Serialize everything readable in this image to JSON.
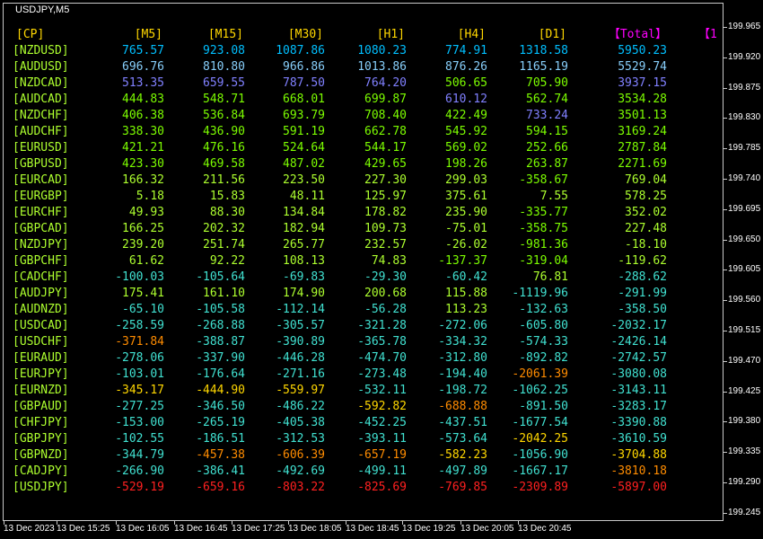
{
  "window": {
    "title": "USDJPY,M5"
  },
  "colors": {
    "background": "#000000",
    "header_gold": "#ffd700",
    "header_magenta": "#ff00ff",
    "pair_label": "#adff2f",
    "strong_blue": "#00bfff",
    "light_blue": "#87cefa",
    "slate_blue": "#8080ff",
    "green": "#7cfc00",
    "lime": "#adff2f",
    "aqua": "#40e0d0",
    "gold": "#ffd700",
    "orange": "#ff8c00",
    "tomato": "#ff6347",
    "red": "#ff2020"
  },
  "table": {
    "headers": [
      "[CP]",
      "[M5]",
      "[M15]",
      "[M30]",
      "[H1]",
      "[H4]",
      "[D1]",
      "【Total】",
      "【1"
    ],
    "rows": [
      {
        "pair": "[NZDUSD]",
        "values": [
          "765.57",
          "923.08",
          "1087.86",
          "1080.23",
          "774.91",
          "1318.58",
          "5950.23"
        ],
        "colors": [
          "strong_blue",
          "strong_blue",
          "strong_blue",
          "strong_blue",
          "strong_blue",
          "strong_blue",
          "strong_blue"
        ]
      },
      {
        "pair": "[AUDUSD]",
        "values": [
          "696.76",
          "810.80",
          "966.86",
          "1013.86",
          "876.26",
          "1165.19",
          "5529.74"
        ],
        "colors": [
          "light_blue",
          "light_blue",
          "light_blue",
          "light_blue",
          "light_blue",
          "light_blue",
          "light_blue"
        ]
      },
      {
        "pair": "[NZDCAD]",
        "values": [
          "513.35",
          "659.55",
          "787.50",
          "764.20",
          "506.65",
          "705.90",
          "3937.15"
        ],
        "colors": [
          "slate_blue",
          "slate_blue",
          "slate_blue",
          "slate_blue",
          "green",
          "green",
          "slate_blue"
        ]
      },
      {
        "pair": "[AUDCAD]",
        "values": [
          "444.83",
          "548.71",
          "668.01",
          "699.87",
          "610.12",
          "562.74",
          "3534.28"
        ],
        "colors": [
          "green",
          "green",
          "green",
          "green",
          "slate_blue",
          "green",
          "green"
        ]
      },
      {
        "pair": "[NZDCHF]",
        "values": [
          "406.38",
          "536.84",
          "693.79",
          "708.40",
          "422.49",
          "733.24",
          "3501.13"
        ],
        "colors": [
          "green",
          "green",
          "green",
          "green",
          "green",
          "slate_blue",
          "green"
        ]
      },
      {
        "pair": "[AUDCHF]",
        "values": [
          "338.30",
          "436.90",
          "591.19",
          "662.78",
          "545.92",
          "594.15",
          "3169.24"
        ],
        "colors": [
          "green",
          "green",
          "green",
          "green",
          "green",
          "green",
          "green"
        ]
      },
      {
        "pair": "[EURUSD]",
        "values": [
          "421.21",
          "476.16",
          "524.64",
          "544.17",
          "569.02",
          "252.66",
          "2787.84"
        ],
        "colors": [
          "green",
          "green",
          "green",
          "green",
          "green",
          "green",
          "green"
        ]
      },
      {
        "pair": "[GBPUSD]",
        "values": [
          "423.30",
          "469.58",
          "487.02",
          "429.65",
          "198.26",
          "263.87",
          "2271.69"
        ],
        "colors": [
          "green",
          "green",
          "green",
          "green",
          "green",
          "green",
          "green"
        ]
      },
      {
        "pair": "[EURCAD]",
        "values": [
          "166.32",
          "211.56",
          "223.50",
          "227.30",
          "299.03",
          "-358.67",
          "769.04"
        ],
        "colors": [
          "lime",
          "lime",
          "lime",
          "lime",
          "lime",
          "green",
          "lime"
        ]
      },
      {
        "pair": "[EURGBP]",
        "values": [
          "5.18",
          "15.83",
          "48.11",
          "125.97",
          "375.61",
          "7.55",
          "578.25"
        ],
        "colors": [
          "lime",
          "lime",
          "lime",
          "lime",
          "lime",
          "lime",
          "lime"
        ]
      },
      {
        "pair": "[EURCHF]",
        "values": [
          "49.93",
          "88.30",
          "134.84",
          "178.82",
          "235.90",
          "-335.77",
          "352.02"
        ],
        "colors": [
          "lime",
          "lime",
          "lime",
          "lime",
          "lime",
          "green",
          "lime"
        ]
      },
      {
        "pair": "[GBPCAD]",
        "values": [
          "166.25",
          "202.32",
          "182.94",
          "109.73",
          "-75.01",
          "-358.75",
          "227.48"
        ],
        "colors": [
          "lime",
          "lime",
          "lime",
          "lime",
          "lime",
          "green",
          "lime"
        ]
      },
      {
        "pair": "[NZDJPY]",
        "values": [
          "239.20",
          "251.74",
          "265.77",
          "232.57",
          "-26.02",
          "-981.36",
          "-18.10"
        ],
        "colors": [
          "lime",
          "lime",
          "lime",
          "lime",
          "lime",
          "green",
          "lime"
        ]
      },
      {
        "pair": "[GBPCHF]",
        "values": [
          "61.62",
          "92.22",
          "108.13",
          "74.83",
          "-137.37",
          "-319.04",
          "-119.62"
        ],
        "colors": [
          "lime",
          "lime",
          "lime",
          "lime",
          "green",
          "green",
          "lime"
        ]
      },
      {
        "pair": "[CADCHF]",
        "values": [
          "-100.03",
          "-105.64",
          "-69.83",
          "-29.30",
          "-60.42",
          "76.81",
          "-288.62"
        ],
        "colors": [
          "aqua",
          "aqua",
          "aqua",
          "aqua",
          "aqua",
          "lime",
          "aqua"
        ]
      },
      {
        "pair": "[AUDJPY]",
        "values": [
          "175.41",
          "161.10",
          "174.90",
          "200.68",
          "115.88",
          "-1119.96",
          "-291.99"
        ],
        "colors": [
          "lime",
          "lime",
          "lime",
          "lime",
          "lime",
          "aqua",
          "aqua"
        ]
      },
      {
        "pair": "[AUDNZD]",
        "values": [
          "-65.10",
          "-105.58",
          "-112.14",
          "-56.28",
          "113.23",
          "-132.63",
          "-358.50"
        ],
        "colors": [
          "aqua",
          "aqua",
          "aqua",
          "aqua",
          "lime",
          "aqua",
          "aqua"
        ]
      },
      {
        "pair": "[USDCAD]",
        "values": [
          "-258.59",
          "-268.88",
          "-305.57",
          "-321.28",
          "-272.06",
          "-605.80",
          "-2032.17"
        ],
        "colors": [
          "aqua",
          "aqua",
          "aqua",
          "aqua",
          "aqua",
          "aqua",
          "aqua"
        ]
      },
      {
        "pair": "[USDCHF]",
        "values": [
          "-371.84",
          "-388.87",
          "-390.89",
          "-365.78",
          "-334.32",
          "-574.33",
          "-2426.14"
        ],
        "colors": [
          "orange",
          "aqua",
          "aqua",
          "aqua",
          "aqua",
          "aqua",
          "aqua"
        ]
      },
      {
        "pair": "[EURAUD]",
        "values": [
          "-278.06",
          "-337.90",
          "-446.28",
          "-474.70",
          "-312.80",
          "-892.82",
          "-2742.57"
        ],
        "colors": [
          "aqua",
          "aqua",
          "aqua",
          "aqua",
          "aqua",
          "aqua",
          "aqua"
        ]
      },
      {
        "pair": "[EURJPY]",
        "values": [
          "-103.01",
          "-176.64",
          "-271.16",
          "-273.48",
          "-194.40",
          "-2061.39",
          "-3080.08"
        ],
        "colors": [
          "aqua",
          "aqua",
          "aqua",
          "aqua",
          "aqua",
          "orange",
          "aqua"
        ]
      },
      {
        "pair": "[EURNZD]",
        "values": [
          "-345.17",
          "-444.90",
          "-559.97",
          "-532.11",
          "-198.72",
          "-1062.25",
          "-3143.11"
        ],
        "colors": [
          "gold",
          "gold",
          "gold",
          "aqua",
          "aqua",
          "aqua",
          "aqua"
        ]
      },
      {
        "pair": "[GBPAUD]",
        "values": [
          "-277.25",
          "-346.50",
          "-486.22",
          "-592.82",
          "-688.88",
          "-891.50",
          "-3283.17"
        ],
        "colors": [
          "aqua",
          "aqua",
          "aqua",
          "gold",
          "orange",
          "aqua",
          "aqua"
        ]
      },
      {
        "pair": "[CHFJPY]",
        "values": [
          "-153.00",
          "-265.19",
          "-405.38",
          "-452.25",
          "-437.51",
          "-1677.54",
          "-3390.88"
        ],
        "colors": [
          "aqua",
          "aqua",
          "aqua",
          "aqua",
          "aqua",
          "aqua",
          "aqua"
        ]
      },
      {
        "pair": "[GBPJPY]",
        "values": [
          "-102.55",
          "-186.51",
          "-312.53",
          "-393.11",
          "-573.64",
          "-2042.25",
          "-3610.59"
        ],
        "colors": [
          "aqua",
          "aqua",
          "aqua",
          "aqua",
          "aqua",
          "gold",
          "aqua"
        ]
      },
      {
        "pair": "[GBPNZD]",
        "values": [
          "-344.79",
          "-457.38",
          "-606.39",
          "-657.19",
          "-582.23",
          "-1056.90",
          "-3704.88"
        ],
        "colors": [
          "aqua",
          "orange",
          "orange",
          "orange",
          "gold",
          "aqua",
          "gold"
        ]
      },
      {
        "pair": "[CADJPY]",
        "values": [
          "-266.90",
          "-386.41",
          "-492.69",
          "-499.11",
          "-497.89",
          "-1667.17",
          "-3810.18"
        ],
        "colors": [
          "aqua",
          "aqua",
          "aqua",
          "aqua",
          "aqua",
          "aqua",
          "orange"
        ]
      },
      {
        "pair": "[USDJPY]",
        "values": [
          "-529.19",
          "-659.16",
          "-803.22",
          "-825.69",
          "-769.85",
          "-2309.89",
          "-5897.00"
        ],
        "colors": [
          "red",
          "red",
          "red",
          "red",
          "red",
          "red",
          "red"
        ]
      }
    ]
  },
  "price_axis": {
    "labels": [
      "199.965",
      "199.920",
      "199.875",
      "199.830",
      "199.785",
      "199.740",
      "199.695",
      "199.650",
      "199.605",
      "199.560",
      "199.515",
      "199.470",
      "199.425",
      "199.380",
      "199.335",
      "199.290",
      "199.245"
    ]
  },
  "time_axis": {
    "labels": [
      "13 Dec 2023",
      "13 Dec 15:25",
      "13 Dec 16:05",
      "13 Dec 16:45",
      "13 Dec 17:25",
      "13 Dec 18:05",
      "13 Dec 18:45",
      "13 Dec 19:25",
      "13 Dec 20:05",
      "13 Dec 20:45"
    ]
  }
}
